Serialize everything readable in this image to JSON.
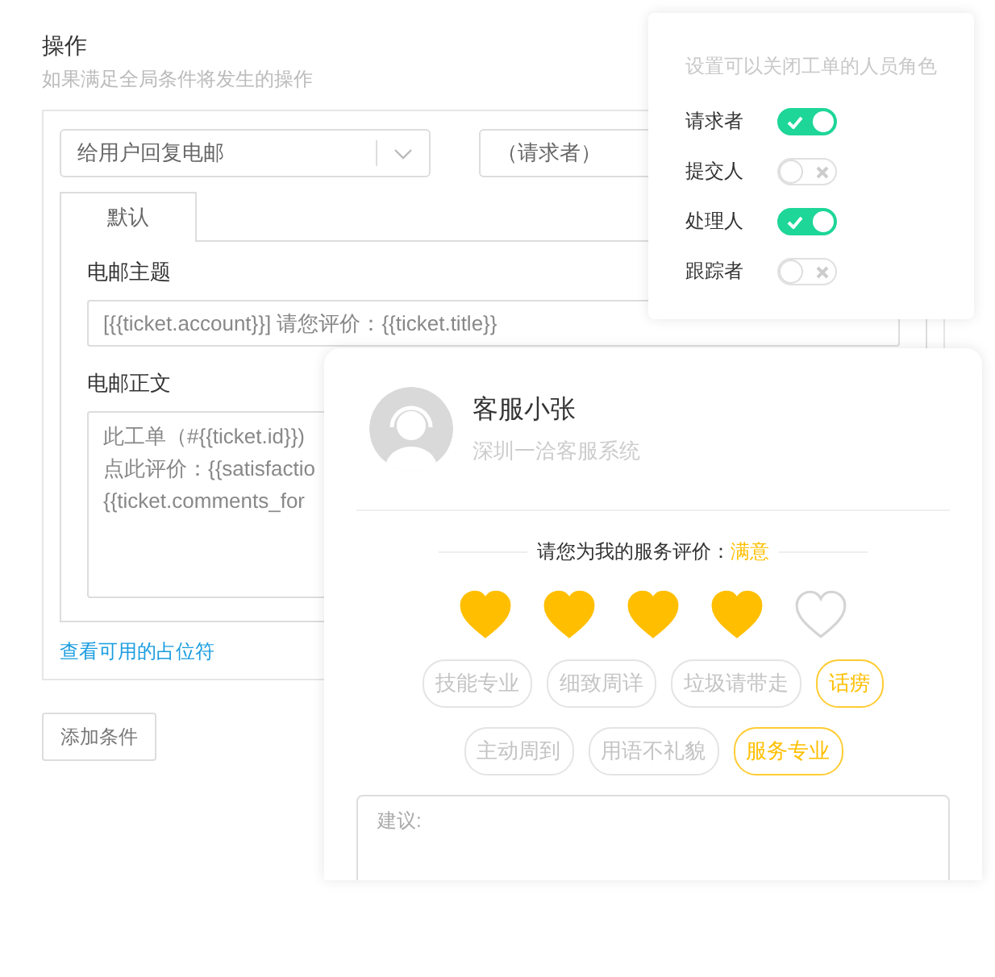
{
  "section": {
    "title": "操作",
    "subtitle": "如果满足全局条件将发生的操作"
  },
  "action": {
    "type_select": "给用户回复电邮",
    "recipient_select": "（请求者）"
  },
  "tabs": [
    {
      "label": "默认",
      "selected": true
    }
  ],
  "subject": {
    "label": "电邮主题",
    "value": "[{{ticket.account}}] 请您评价：{{ticket.title}}"
  },
  "body": {
    "label": "电邮正文",
    "lines": [
      "此工单（#{{ticket.id}})",
      "点此评价：{{satisfactio",
      "{{ticket.comments_for"
    ]
  },
  "placeholder_link": "查看可用的占位符",
  "add_condition_button": "添加条件",
  "close_roles": {
    "title": "设置可以关闭工单的人员角色",
    "roles": [
      {
        "name": "请求者",
        "on": true
      },
      {
        "name": "提交人",
        "on": false
      },
      {
        "name": "处理人",
        "on": true
      },
      {
        "name": "跟踪者",
        "on": false
      }
    ]
  },
  "rating_card": {
    "agent_name": "客服小张",
    "company": "深圳一洽客服系统",
    "prompt": "请您为我的服务评价：",
    "rating_label": "满意",
    "stars": 4,
    "tag_rows": [
      [
        {
          "label": "技能专业",
          "selected": false
        },
        {
          "label": "细致周详",
          "selected": false
        },
        {
          "label": "垃圾请带走",
          "selected": false
        },
        {
          "label": "话痨",
          "selected": true
        }
      ],
      [
        {
          "label": "主动周到",
          "selected": false
        },
        {
          "label": "用语不礼貌",
          "selected": false
        },
        {
          "label": "服务专业",
          "selected": true
        }
      ]
    ],
    "suggestion": {
      "placeholder": "建议:"
    }
  }
}
